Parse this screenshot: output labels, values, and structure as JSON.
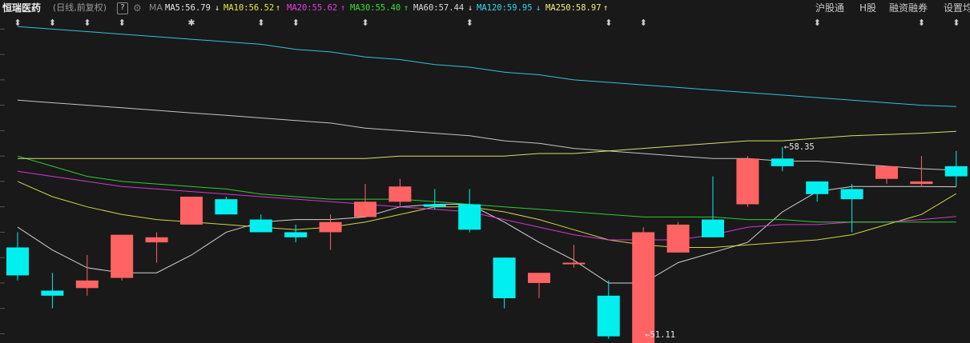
{
  "header": {
    "stock_name": "恒瑞医药",
    "period": "(日线,前复权)",
    "help": "?",
    "indicator": "MA",
    "ma_items": [
      {
        "label": "MA5:56.79",
        "arrow": "↓",
        "color": "#e6e6e6"
      },
      {
        "label": "MA10:56.52",
        "arrow": "↑",
        "color": "#e8e84a"
      },
      {
        "label": "MA20:55.62",
        "arrow": "↑",
        "color": "#e83ae8"
      },
      {
        "label": "MA30:55.40",
        "arrow": "↑",
        "color": "#33e033"
      },
      {
        "label": "MA60:57.44",
        "arrow": "↓",
        "color": "#d8d8d8"
      },
      {
        "label": "MA120:59.95",
        "arrow": "↓",
        "color": "#33d6f0"
      },
      {
        "label": "MA250:58.97",
        "arrow": "↑",
        "color": "#f0f07a"
      }
    ],
    "right_links": [
      "沪股通",
      "H股",
      "融资融券",
      "设置均"
    ]
  },
  "colors": {
    "up": "#ff6363",
    "down": "#00f0f0",
    "background": "#191919"
  },
  "chart_data": {
    "type": "candlestick",
    "ylim": [
      50.7,
      63.2
    ],
    "candles": [
      {
        "o": 54.4,
        "h": 55.0,
        "l": 53.1,
        "c": 53.3
      },
      {
        "o": 52.7,
        "h": 53.4,
        "l": 52.0,
        "c": 52.5
      },
      {
        "o": 52.8,
        "h": 54.1,
        "l": 52.5,
        "c": 53.1
      },
      {
        "o": 53.2,
        "h": 54.9,
        "l": 53.1,
        "c": 54.9
      },
      {
        "o": 54.6,
        "h": 55.0,
        "l": 53.8,
        "c": 54.8
      },
      {
        "o": 55.3,
        "h": 56.4,
        "l": 55.3,
        "c": 56.4
      },
      {
        "o": 56.3,
        "h": 56.4,
        "l": 55.7,
        "c": 55.7
      },
      {
        "o": 55.5,
        "h": 55.7,
        "l": 55.0,
        "c": 55.0
      },
      {
        "o": 55.0,
        "h": 55.3,
        "l": 54.6,
        "c": 54.8
      },
      {
        "o": 55.0,
        "h": 55.7,
        "l": 54.3,
        "c": 55.4
      },
      {
        "o": 55.6,
        "h": 56.9,
        "l": 55.6,
        "c": 56.2
      },
      {
        "o": 56.2,
        "h": 57.1,
        "l": 56.0,
        "c": 56.8
      },
      {
        "o": 56.1,
        "h": 56.7,
        "l": 55.9,
        "c": 56.0
      },
      {
        "o": 56.1,
        "h": 56.7,
        "l": 55.0,
        "c": 55.1
      },
      {
        "o": 54.0,
        "h": 54.0,
        "l": 52.0,
        "c": 52.4
      },
      {
        "o": 53.0,
        "h": 53.2,
        "l": 52.4,
        "c": 53.4
      },
      {
        "o": 53.8,
        "h": 54.5,
        "l": 53.6,
        "c": 53.8
      },
      {
        "o": 52.5,
        "h": 53.1,
        "l": 50.8,
        "c": 50.9
      },
      {
        "o": 50.5,
        "h": 55.2,
        "l": 50.5,
        "c": 55.0
      },
      {
        "o": 54.2,
        "h": 55.4,
        "l": 54.2,
        "c": 55.3
      },
      {
        "o": 55.5,
        "h": 57.2,
        "l": 54.8,
        "c": 54.8
      },
      {
        "o": 56.1,
        "h": 58.0,
        "l": 56.0,
        "c": 57.9
      },
      {
        "o": 57.9,
        "h": 58.35,
        "l": 57.4,
        "c": 57.6
      },
      {
        "o": 57.0,
        "h": 57.0,
        "l": 56.2,
        "c": 56.5
      },
      {
        "o": 56.7,
        "h": 56.9,
        "l": 55.0,
        "c": 56.3
      },
      {
        "o": 57.1,
        "h": 57.6,
        "l": 56.9,
        "c": 57.6
      },
      {
        "o": 56.9,
        "h": 58.0,
        "l": 56.8,
        "c": 57.0
      },
      {
        "o": 57.6,
        "h": 58.2,
        "l": 56.8,
        "c": 57.2
      }
    ],
    "ma_lines": [
      {
        "name": "MA5",
        "color": "#e6e6e6",
        "values": [
          55.2,
          54.3,
          53.6,
          53.4,
          53.4,
          54.1,
          55.0,
          55.4,
          55.5,
          55.5,
          55.6,
          56.0,
          56.1,
          56.1,
          55.4,
          54.6,
          53.9,
          53.0,
          53.0,
          53.8,
          54.2,
          54.6,
          55.8,
          56.6,
          56.8,
          56.8,
          56.8,
          56.79
        ]
      },
      {
        "name": "MA10",
        "color": "#e8e84a",
        "values": [
          57.0,
          56.4,
          56.0,
          55.7,
          55.5,
          55.4,
          55.3,
          55.2,
          55.1,
          55.2,
          55.4,
          55.7,
          56.0,
          56.0,
          55.8,
          55.5,
          55.1,
          54.7,
          54.5,
          54.4,
          54.4,
          54.5,
          54.6,
          54.7,
          54.9,
          55.3,
          55.7,
          56.52
        ]
      },
      {
        "name": "MA20",
        "color": "#e83ae8",
        "values": [
          57.4,
          57.2,
          57.0,
          56.8,
          56.7,
          56.6,
          56.5,
          56.4,
          56.3,
          56.2,
          56.1,
          56.0,
          55.9,
          55.8,
          55.5,
          55.2,
          54.9,
          54.7,
          54.7,
          54.7,
          54.9,
          55.2,
          55.3,
          55.3,
          55.4,
          55.4,
          55.5,
          55.62
        ]
      },
      {
        "name": "MA30",
        "color": "#33e033",
        "values": [
          58.0,
          57.6,
          57.2,
          57.0,
          56.9,
          56.8,
          56.7,
          56.5,
          56.4,
          56.3,
          56.3,
          56.3,
          56.2,
          56.1,
          56.0,
          55.9,
          55.8,
          55.7,
          55.6,
          55.6,
          55.6,
          55.5,
          55.5,
          55.4,
          55.4,
          55.4,
          55.4,
          55.4
        ]
      },
      {
        "name": "MA60",
        "color": "#d8d8d8",
        "values": [
          60.2,
          60.1,
          60.0,
          59.9,
          59.8,
          59.7,
          59.6,
          59.5,
          59.4,
          59.3,
          59.1,
          59.0,
          58.9,
          58.8,
          58.6,
          58.5,
          58.3,
          58.2,
          58.1,
          58.0,
          57.9,
          57.9,
          57.8,
          57.8,
          57.7,
          57.6,
          57.5,
          57.44
        ]
      },
      {
        "name": "MA120",
        "color": "#33d6f0",
        "values": [
          63.1,
          63.0,
          62.9,
          62.8,
          62.7,
          62.6,
          62.5,
          62.4,
          62.2,
          62.1,
          61.9,
          61.8,
          61.6,
          61.5,
          61.3,
          61.2,
          61.0,
          60.9,
          60.8,
          60.7,
          60.6,
          60.5,
          60.4,
          60.3,
          60.2,
          60.1,
          60.0,
          59.95
        ]
      },
      {
        "name": "MA250",
        "color": "#f0f07a",
        "values": [
          57.9,
          57.9,
          57.9,
          57.9,
          57.9,
          57.9,
          57.9,
          57.9,
          57.9,
          57.9,
          57.9,
          58.0,
          58.0,
          58.0,
          58.0,
          58.1,
          58.1,
          58.2,
          58.3,
          58.4,
          58.5,
          58.6,
          58.6,
          58.7,
          58.8,
          58.85,
          58.9,
          58.97
        ]
      }
    ],
    "annotations": [
      {
        "label": "58.35",
        "candle_index": 22,
        "value": 58.35
      },
      {
        "label": "51.11",
        "candle_index": 18,
        "value": 51.11
      }
    ],
    "event_markers": [
      {
        "candle_index": 0,
        "symbol": "⬍"
      },
      {
        "candle_index": 1,
        "symbol": "⬍"
      },
      {
        "candle_index": 2,
        "symbol": "⬍"
      },
      {
        "candle_index": 3,
        "symbol": "⬍"
      },
      {
        "candle_index": 5,
        "symbol": "✱"
      },
      {
        "candle_index": 7,
        "symbol": "⬍"
      },
      {
        "candle_index": 8,
        "symbol": "⬍"
      },
      {
        "candle_index": 10,
        "symbol": "⬍"
      },
      {
        "candle_index": 13,
        "symbol": "⬍"
      },
      {
        "candle_index": 17,
        "symbol": "⬍"
      },
      {
        "candle_index": 18,
        "symbol": "⬍"
      },
      {
        "candle_index": 23,
        "symbol": "⬍"
      },
      {
        "candle_index": 26,
        "symbol": "⬍"
      },
      {
        "candle_index": 27,
        "symbol": "⬍"
      }
    ]
  }
}
